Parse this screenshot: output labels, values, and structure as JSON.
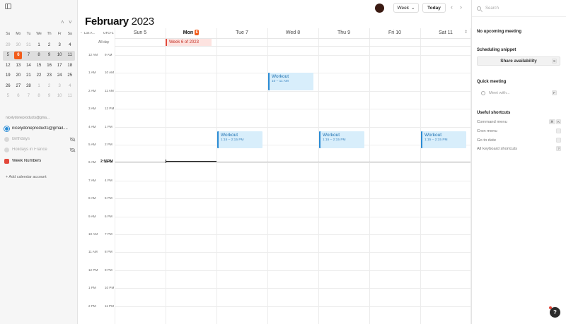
{
  "mini_calendar": {
    "prev": "˄",
    "next": "˅",
    "weekdays": [
      "Su",
      "Mo",
      "Tu",
      "We",
      "Th",
      "Fr",
      "Sa"
    ],
    "weeks": [
      [
        {
          "d": "29",
          "other": true
        },
        {
          "d": "30",
          "other": true
        },
        {
          "d": "31",
          "other": true
        },
        {
          "d": "1"
        },
        {
          "d": "2"
        },
        {
          "d": "3"
        },
        {
          "d": "4"
        }
      ],
      [
        {
          "d": "5"
        },
        {
          "d": "6",
          "today": true
        },
        {
          "d": "7"
        },
        {
          "d": "8"
        },
        {
          "d": "9"
        },
        {
          "d": "10"
        },
        {
          "d": "11"
        }
      ],
      [
        {
          "d": "12"
        },
        {
          "d": "13"
        },
        {
          "d": "14"
        },
        {
          "d": "15"
        },
        {
          "d": "16"
        },
        {
          "d": "17"
        },
        {
          "d": "18"
        }
      ],
      [
        {
          "d": "19"
        },
        {
          "d": "20"
        },
        {
          "d": "21"
        },
        {
          "d": "22"
        },
        {
          "d": "23"
        },
        {
          "d": "24"
        },
        {
          "d": "25"
        }
      ],
      [
        {
          "d": "26"
        },
        {
          "d": "27"
        },
        {
          "d": "28"
        },
        {
          "d": "1",
          "other": true
        },
        {
          "d": "2",
          "other": true
        },
        {
          "d": "3",
          "other": true
        },
        {
          "d": "4",
          "other": true
        }
      ],
      [
        {
          "d": "5",
          "other": true
        },
        {
          "d": "6",
          "other": true
        },
        {
          "d": "7",
          "other": true
        },
        {
          "d": "8",
          "other": true
        },
        {
          "d": "9",
          "other": true
        },
        {
          "d": "10",
          "other": true
        },
        {
          "d": "11",
          "other": true
        }
      ]
    ],
    "current_week_index": 1
  },
  "sidebar": {
    "account_label": "nicelydoneproducts@gma...",
    "calendars": [
      {
        "label": "nicelydoneproducts@gmail....",
        "color": "#2a8bd4",
        "ring": true,
        "dim": false,
        "hidden_icon": false
      },
      {
        "label": "Birthdays",
        "color": "#d8d8d8",
        "ring": false,
        "dim": true,
        "hidden_icon": true
      },
      {
        "label": "Holidays in France",
        "color": "#d8d8d8",
        "ring": false,
        "dim": true,
        "hidden_icon": true
      },
      {
        "label": "Week Numbers",
        "color": "#e2483a",
        "ring": false,
        "dim": false,
        "hidden_icon": false
      }
    ],
    "add_account": "+ Add calendar account"
  },
  "header": {
    "month": "February",
    "year": "2023",
    "view": "Week",
    "view_chevron": "⌄",
    "today": "Today",
    "prev": "‹",
    "next": "›"
  },
  "timezones": {
    "chevron": "⌄",
    "primary": "Los A...",
    "secondary": "UTC+1"
  },
  "days": [
    {
      "name": "Sun",
      "num": "5",
      "today": false
    },
    {
      "name": "Mon",
      "num": "6",
      "today": true
    },
    {
      "name": "Tue",
      "num": "7",
      "today": false
    },
    {
      "name": "Wed",
      "num": "8",
      "today": false
    },
    {
      "name": "Thu",
      "num": "9",
      "today": false
    },
    {
      "name": "Fri",
      "num": "10",
      "today": false
    },
    {
      "name": "Sat",
      "num": "11",
      "today": false
    }
  ],
  "expand_icon": "⇕",
  "allday": {
    "label": "All-day",
    "week_chip": "Week 6 of 2023"
  },
  "hours": [
    {
      "left": "12 AM",
      "right": "9 AM"
    },
    {
      "left": "1 AM",
      "right": "10 AM"
    },
    {
      "left": "2 AM",
      "right": "11 AM"
    },
    {
      "left": "3 AM",
      "right": "12 PM"
    },
    {
      "left": "4 AM",
      "right": "1 PM"
    },
    {
      "left": "5 AM",
      "right": "2 PM"
    },
    {
      "left": "6 AM",
      "right": "3 PM"
    },
    {
      "left": "7 AM",
      "right": "4 PM"
    },
    {
      "left": "8 AM",
      "right": "5 PM"
    },
    {
      "left": "9 AM",
      "right": "6 PM"
    },
    {
      "left": "10 AM",
      "right": "7 PM"
    },
    {
      "left": "11 AM",
      "right": "8 PM"
    },
    {
      "left": "12 PM",
      "right": "9 PM"
    },
    {
      "left": "1 PM",
      "right": "10 PM"
    },
    {
      "left": "2 PM",
      "right": "11 PM"
    }
  ],
  "now": {
    "label": "2:56PM",
    "hour": 5.93
  },
  "events": [
    {
      "title": "Workout",
      "time": "10 – 11 AM",
      "day": 3,
      "start": 1.0,
      "end": 2.0
    },
    {
      "title": "Workout",
      "time": "1:15 – 2:15 PM",
      "day": 2,
      "start": 4.25,
      "end": 5.25
    },
    {
      "title": "Workout",
      "time": "1:15 – 2:15 PM",
      "day": 4,
      "start": 4.25,
      "end": 5.25
    },
    {
      "title": "Workout",
      "time": "1:15 – 2:15 PM",
      "day": 6,
      "start": 4.25,
      "end": 5.25
    }
  ],
  "right_panel": {
    "search_placeholder": "Search",
    "no_meeting": "No upcoming meeting",
    "scheduling_title": "Scheduling snippet",
    "share_label": "Share availability",
    "share_key": "S",
    "quick_title": "Quick meeting",
    "meet_placeholder": "Meet with...",
    "meet_key": "F",
    "shortcuts_title": "Useful shortcuts",
    "shortcuts": [
      {
        "label": "Command menu",
        "keys": [
          "⌘",
          "K"
        ]
      },
      {
        "label": "Cron menu",
        "keys": [
          ""
        ]
      },
      {
        "label": "Go to date",
        "keys": [
          ""
        ]
      },
      {
        "label": "All keyboard shortcuts",
        "keys": [
          "?"
        ]
      }
    ],
    "help": "?"
  },
  "colors": {
    "accent": "#f25c1a",
    "event_bg": "#d8eefb",
    "event_border": "#2a8bd4",
    "week_chip": "#e2483a"
  }
}
